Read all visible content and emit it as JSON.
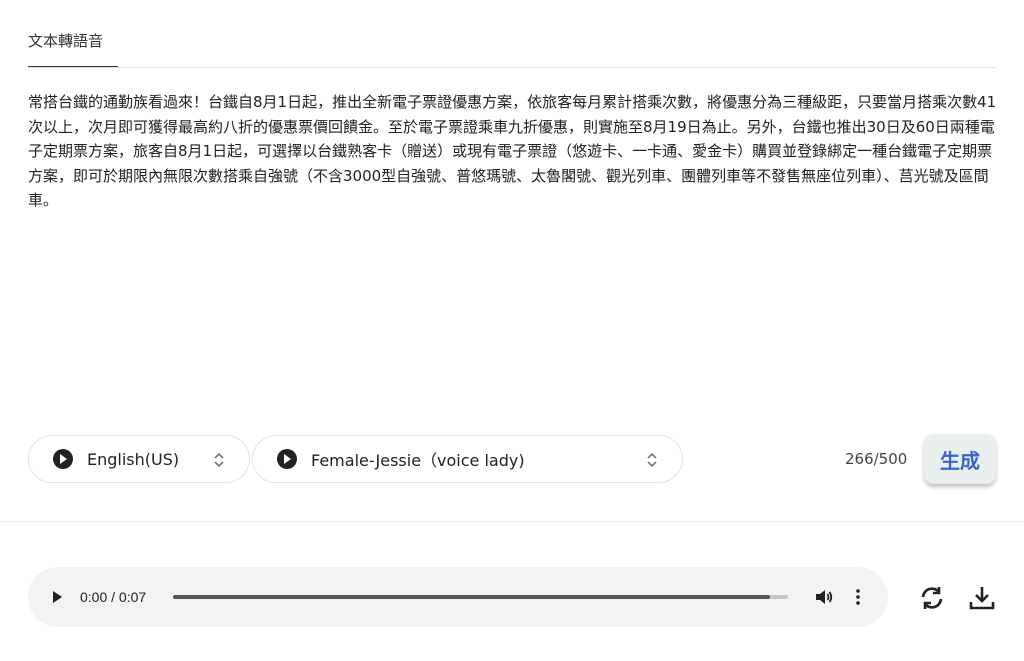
{
  "tabs": [
    {
      "label": "文本轉語音",
      "active": true
    }
  ],
  "editor": {
    "text": "常搭台鐵的通勤族看過來！台鐵自8月1日起，推出全新電子票證優惠方案，依旅客每月累計搭乘次數，將優惠分為三種級距，只要當月搭乘次數41次以上，次月即可獲得最高約八折的優惠票價回饋金。至於電子票證乘車九折優惠，則實施至8月19日為止。另外，台鐵也推出30日及60日兩種電子定期票方案，旅客自8月1日起，可選擇以台鐵熟客卡（贈送）或現有電子票證（悠遊卡、一卡通、愛金卡）購買並登錄綁定一種台鐵電子定期票方案，即可於期限內無限次數搭乘自強號（不含3000型自強號、普悠瑪號、太魯閣號、觀光列車、團體列車等不發售無座位列車）、莒光號及區間車。"
  },
  "controls": {
    "language": {
      "value": "English(US)",
      "icon": "play-circle-icon"
    },
    "voice": {
      "value": "Female-Jessie（voice lady)",
      "icon": "play-circle-icon"
    },
    "char_count": "266/500",
    "generate_label": "生成",
    "accent_color": "#3a63c8"
  },
  "player": {
    "time": "0:00 / 0:07",
    "progress": 0.0,
    "buffered": 0.97,
    "icons": [
      "play-icon",
      "volume-icon",
      "more-vert-icon"
    ]
  },
  "actions": {
    "icons": [
      "refresh-icon",
      "download-icon"
    ]
  }
}
